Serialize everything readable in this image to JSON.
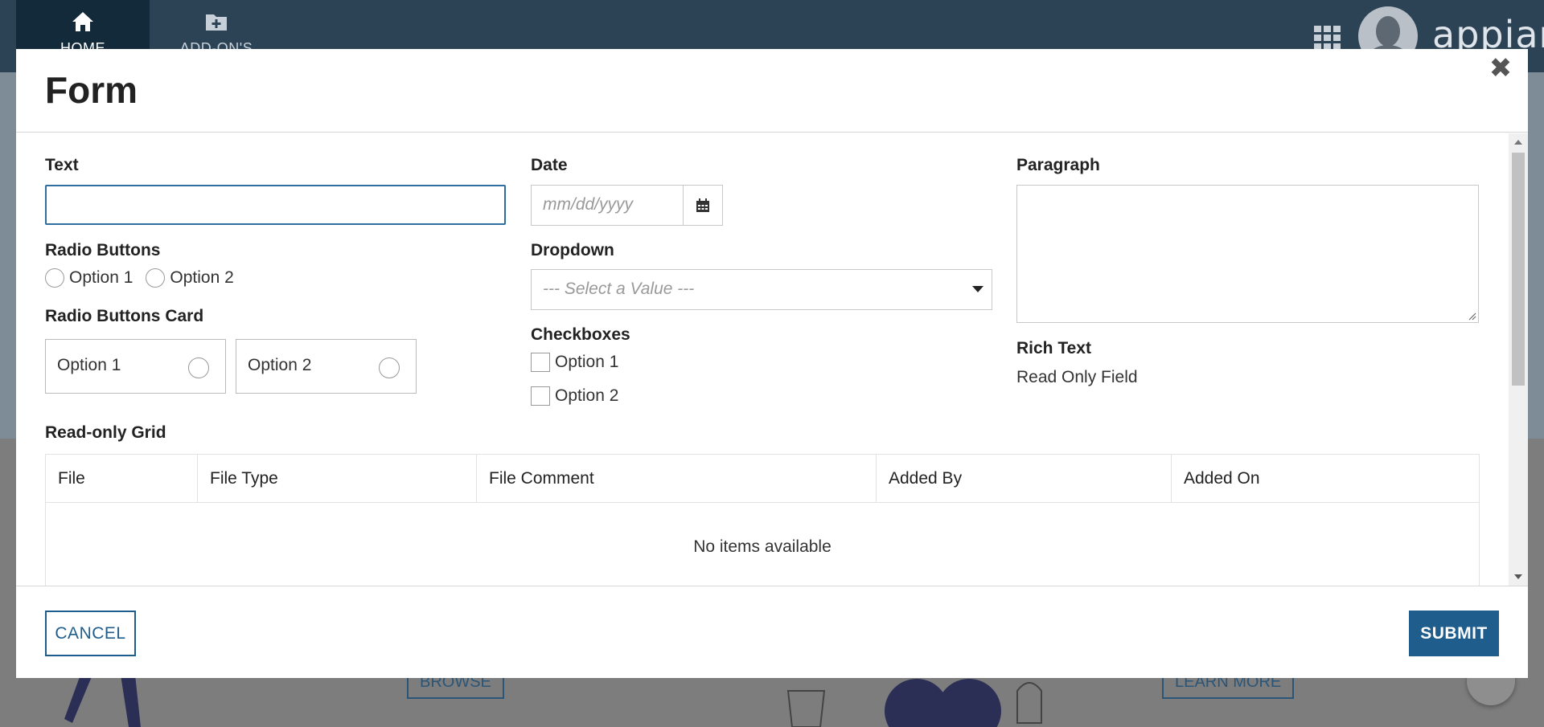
{
  "nav": {
    "tabs": [
      {
        "label": "HOME",
        "icon": "home-icon"
      },
      {
        "label": "ADD-ON'S",
        "icon": "folder-plus-icon"
      }
    ],
    "logo": "appian"
  },
  "background": {
    "browse_label": "BROWSE",
    "learn_more_label": "LEARN MORE"
  },
  "modal": {
    "title": "Form",
    "close_icon": "close-icon",
    "fields": {
      "text_label": "Text",
      "text_value": "",
      "radio_label": "Radio Buttons",
      "radio_options": [
        "Option 1",
        "Option 2"
      ],
      "radio_card_label": "Radio Buttons Card",
      "radio_card_options": [
        "Option 1",
        "Option 2"
      ],
      "date_label": "Date",
      "date_placeholder": "mm/dd/yyyy",
      "dropdown_label": "Dropdown",
      "dropdown_placeholder": "--- Select a Value ---",
      "checkbox_label": "Checkboxes",
      "checkbox_options": [
        "Option 1",
        "Option 2"
      ],
      "paragraph_label": "Paragraph",
      "rich_text_label": "Rich Text",
      "rich_text_value": "Read Only Field"
    },
    "grid": {
      "label": "Read-only Grid",
      "columns": [
        "File",
        "File Type",
        "File Comment",
        "Added By",
        "Added On"
      ],
      "empty_text": "No items available"
    },
    "footer": {
      "cancel_label": "CANCEL",
      "submit_label": "SUBMIT"
    }
  },
  "colors": {
    "accent": "#1f5d8c",
    "topbar": "#2c4356",
    "input_focus": "#2f6fa0"
  }
}
